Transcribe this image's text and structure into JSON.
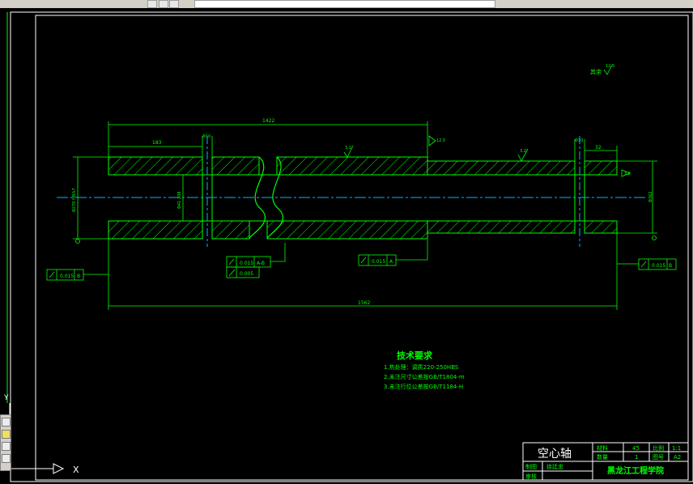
{
  "drawing": {
    "dims": {
      "left_len": "183",
      "total_top": "1422",
      "hole_left": "Φ10",
      "hole_right": "Φ10",
      "right_len": "32",
      "total_len": "1562",
      "od_left": "Φ270 H8/k7",
      "bore": "Φ41 208",
      "od_right": "Φ362"
    },
    "rough": {
      "a": "3.2",
      "b": "12.5",
      "c": "3.2",
      "d": "3.2",
      "e": "3.2",
      "rest_label": "其余",
      "rest_val": "12.5"
    },
    "tolerance": {
      "f1_val": "0.015",
      "f1_ref": "B",
      "f2_val": "0.015",
      "f2_ref": "A-B",
      "f3_val": "0.005",
      "f4_val": "0.015",
      "f4_ref": "A",
      "f5_val": "0.015",
      "f5_ref": "B"
    },
    "datums": {
      "left": "A",
      "right": "B"
    },
    "notes": {
      "title": "技术要求",
      "line1": "1.热处理：调质220-250HBS",
      "line2": "2.未注尺寸公差按GB/T1804-m",
      "line3": "3.未注行位公差按GB/T1184-H"
    },
    "title_block": {
      "part_name": "空心轴",
      "material_label": "材料",
      "material": "45",
      "scale_label": "比例",
      "scale": "1:1",
      "qty_label": "数量",
      "qty": "1",
      "sheet_label": "图号",
      "sheet": "A2",
      "drawn_label": "制图",
      "drawn_by": "徐廷忠",
      "checked_label": "审核",
      "school": "黑龙江工程学院"
    },
    "ucs": {
      "x": "X",
      "y": "Y"
    }
  },
  "colors": {
    "line": "#00ff00",
    "bg": "#000000",
    "center": "#00b3ff"
  }
}
